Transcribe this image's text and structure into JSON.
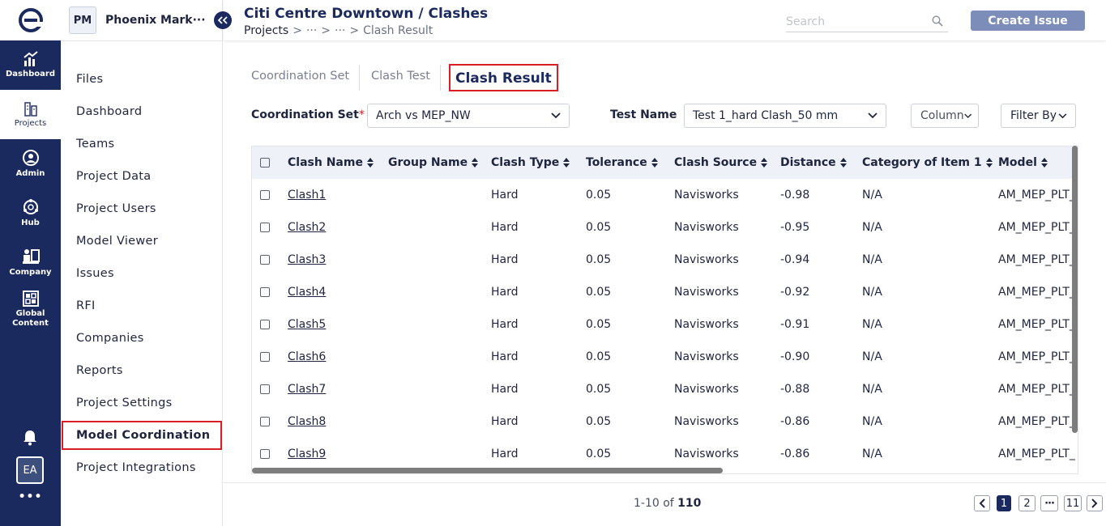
{
  "rail": {
    "items": [
      {
        "label": "Dashboard"
      },
      {
        "label": "Projects"
      },
      {
        "label": "Admin"
      },
      {
        "label": "Hub"
      },
      {
        "label": "Company"
      },
      {
        "label": "Global Content"
      }
    ],
    "avatar": "EA",
    "more": "•••"
  },
  "sidebar": {
    "project_badge": "PM",
    "project_name": "Phoenix Mark···",
    "items": [
      {
        "label": "Files"
      },
      {
        "label": "Dashboard"
      },
      {
        "label": "Teams"
      },
      {
        "label": "Project Data"
      },
      {
        "label": "Project Users"
      },
      {
        "label": "Model Viewer"
      },
      {
        "label": "Issues"
      },
      {
        "label": "RFI"
      },
      {
        "label": "Companies"
      },
      {
        "label": "Reports"
      },
      {
        "label": "Project Settings"
      },
      {
        "label": "Model Coordination"
      },
      {
        "label": "Project Integrations"
      }
    ]
  },
  "header": {
    "title": "Citi Centre Downtown / Clashes",
    "breadcrumb": {
      "root": "Projects",
      "sep": ">",
      "ellipsis1": "···",
      "ellipsis2": "···",
      "current": "Clash Result"
    },
    "search_placeholder": "Search",
    "create_label": "Create Issue"
  },
  "tabs": [
    {
      "label": "Coordination Set"
    },
    {
      "label": "Clash Test"
    },
    {
      "label": "Clash Result"
    }
  ],
  "filters": {
    "coord_label": "Coordination Set",
    "coord_required": "*",
    "coord_value": "Arch vs MEP_NW",
    "test_label": "Test Name",
    "test_value": "Test 1_hard Clash_50 mm",
    "columns_label": "Column",
    "filter_label": "Filter By"
  },
  "table": {
    "columns": [
      "Clash Name",
      "Group Name",
      "Clash Type",
      "Tolerance",
      "Clash Source",
      "Distance",
      "Category of Item 1",
      "Model"
    ],
    "rows": [
      {
        "name": "Clash1",
        "group": "",
        "type": "Hard",
        "tolerance": "0.05",
        "source": "Navisworks",
        "distance": "-0.98",
        "category": "N/A",
        "model": "AM_MEP_PLT_"
      },
      {
        "name": "Clash2",
        "group": "",
        "type": "Hard",
        "tolerance": "0.05",
        "source": "Navisworks",
        "distance": "-0.95",
        "category": "N/A",
        "model": "AM_MEP_PLT_"
      },
      {
        "name": "Clash3",
        "group": "",
        "type": "Hard",
        "tolerance": "0.05",
        "source": "Navisworks",
        "distance": "-0.94",
        "category": "N/A",
        "model": "AM_MEP_PLT_"
      },
      {
        "name": "Clash4",
        "group": "",
        "type": "Hard",
        "tolerance": "0.05",
        "source": "Navisworks",
        "distance": "-0.92",
        "category": "N/A",
        "model": "AM_MEP_PLT_"
      },
      {
        "name": "Clash5",
        "group": "",
        "type": "Hard",
        "tolerance": "0.05",
        "source": "Navisworks",
        "distance": "-0.91",
        "category": "N/A",
        "model": "AM_MEP_PLT_"
      },
      {
        "name": "Clash6",
        "group": "",
        "type": "Hard",
        "tolerance": "0.05",
        "source": "Navisworks",
        "distance": "-0.90",
        "category": "N/A",
        "model": "AM_MEP_PLT_"
      },
      {
        "name": "Clash7",
        "group": "",
        "type": "Hard",
        "tolerance": "0.05",
        "source": "Navisworks",
        "distance": "-0.88",
        "category": "N/A",
        "model": "AM_MEP_PLT_"
      },
      {
        "name": "Clash8",
        "group": "",
        "type": "Hard",
        "tolerance": "0.05",
        "source": "Navisworks",
        "distance": "-0.86",
        "category": "N/A",
        "model": "AM_MEP_PLT_"
      },
      {
        "name": "Clash9",
        "group": "",
        "type": "Hard",
        "tolerance": "0.05",
        "source": "Navisworks",
        "distance": "-0.86",
        "category": "N/A",
        "model": "AM_MEP_PLT_"
      }
    ]
  },
  "pagination": {
    "range": "1-10 of",
    "total": "110",
    "pages": [
      "1",
      "2",
      "···",
      "11"
    ]
  }
}
